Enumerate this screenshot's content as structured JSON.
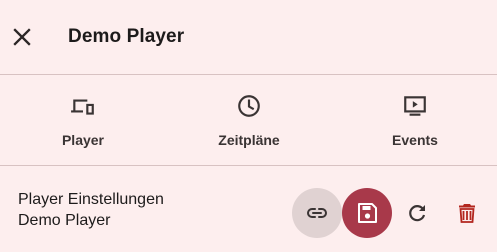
{
  "header": {
    "title": "Demo Player",
    "close_icon": "close-icon"
  },
  "tabs": [
    {
      "label": "Player",
      "icon": "devices-icon"
    },
    {
      "label": "Zeitpläne",
      "icon": "clock-icon"
    },
    {
      "label": "Events",
      "icon": "slideshow-icon"
    }
  ],
  "settings": {
    "heading": "Player Einstellungen",
    "player_name": "Demo Player"
  },
  "actions": [
    {
      "icon": "link-icon"
    },
    {
      "icon": "save-icon"
    },
    {
      "icon": "refresh-icon"
    },
    {
      "icon": "delete-icon"
    }
  ],
  "colors": {
    "background": "#fdeeee",
    "primary": "#a8394a",
    "danger": "#b3261e",
    "divider": "#d8c2c2",
    "link_button_bg": "#e0d2d2"
  }
}
